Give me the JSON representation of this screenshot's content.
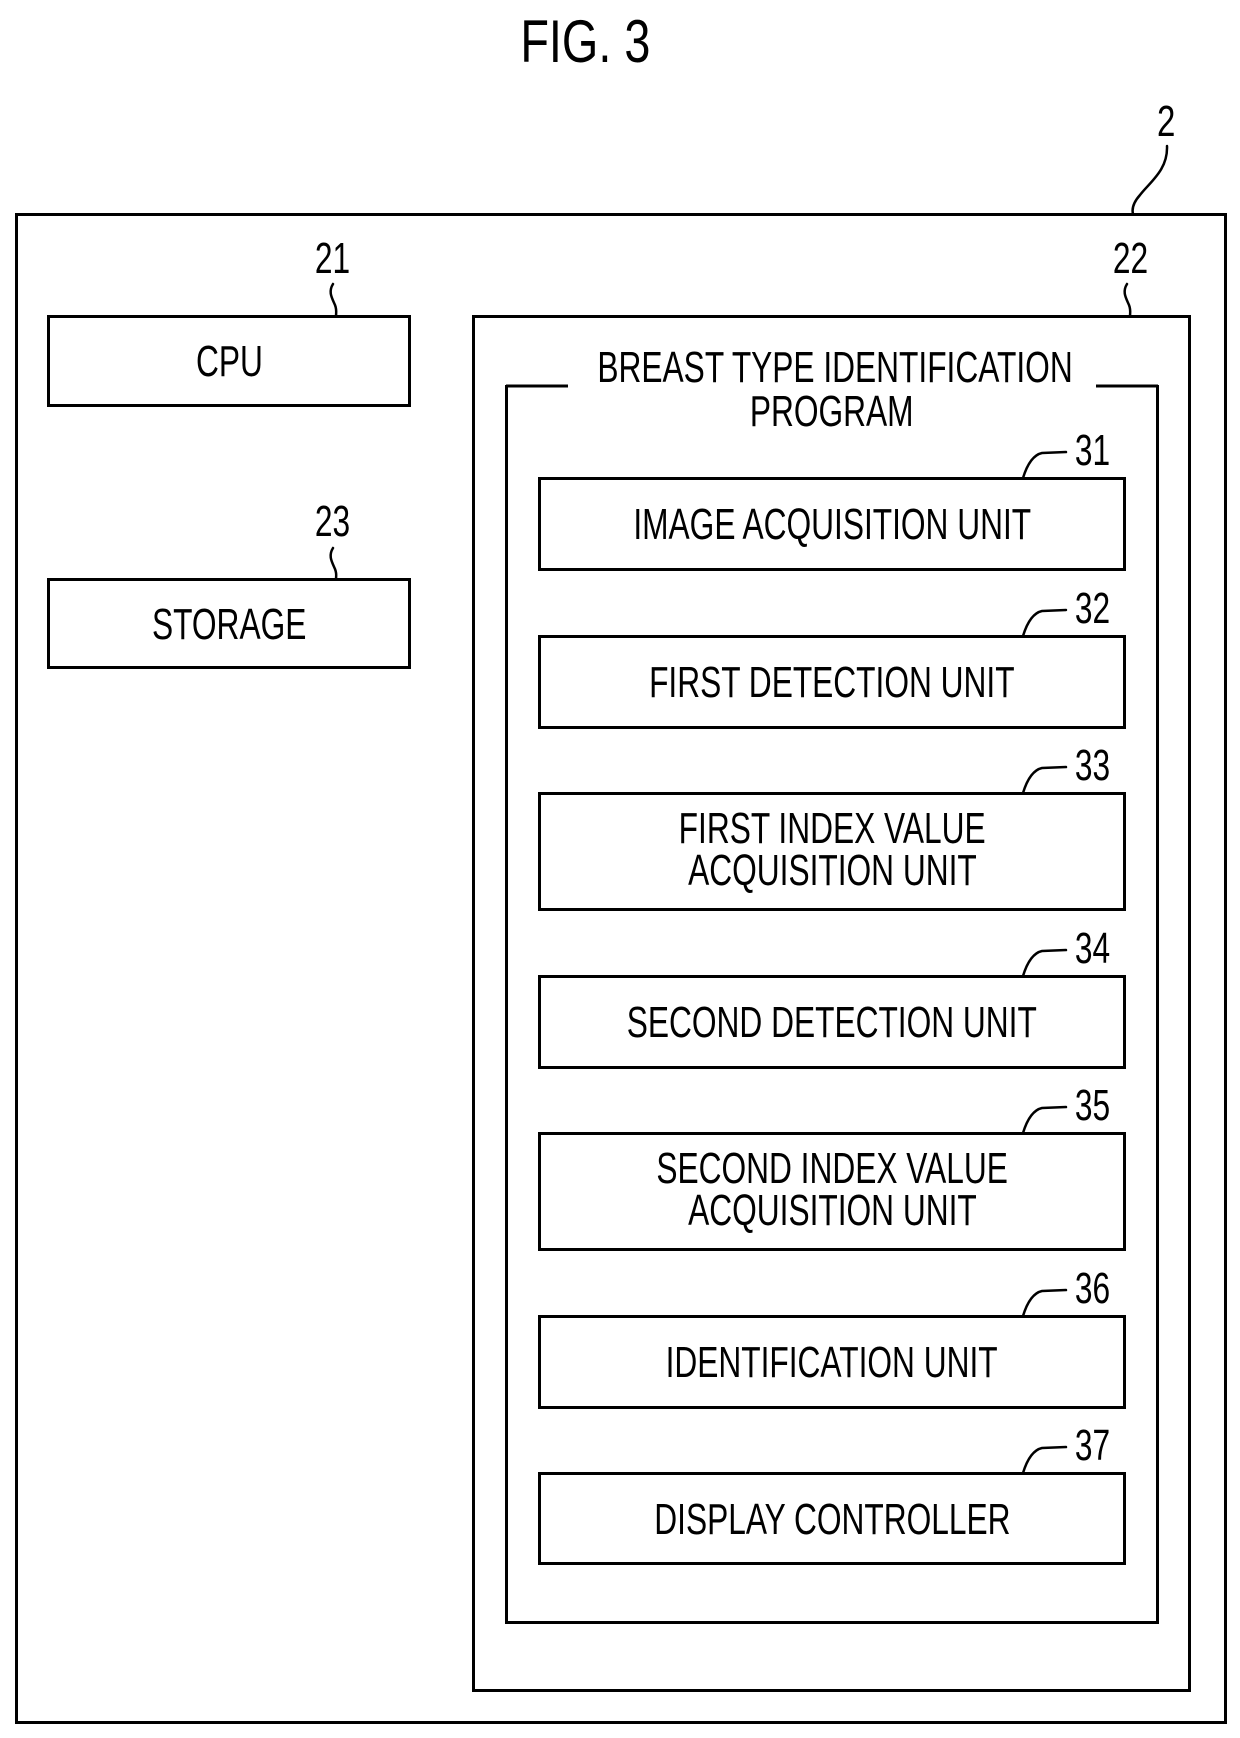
{
  "figure": {
    "title": "FIG. 3"
  },
  "device": {
    "ref": "2",
    "cpu": {
      "ref": "21",
      "label": "CPU"
    },
    "storage": {
      "ref": "23",
      "label": "STORAGE"
    },
    "memory": {
      "ref": "22",
      "program": {
        "title_line1": "BREAST TYPE IDENTIFICATION",
        "title_line2": "PROGRAM",
        "units": [
          {
            "ref": "31",
            "line1": "IMAGE ACQUISITION UNIT",
            "line2": ""
          },
          {
            "ref": "32",
            "line1": "FIRST DETECTION UNIT",
            "line2": ""
          },
          {
            "ref": "33",
            "line1": "FIRST INDEX VALUE",
            "line2": "ACQUISITION UNIT"
          },
          {
            "ref": "34",
            "line1": "SECOND DETECTION UNIT",
            "line2": ""
          },
          {
            "ref": "35",
            "line1": "SECOND INDEX VALUE",
            "line2": "ACQUISITION UNIT"
          },
          {
            "ref": "36",
            "line1": "IDENTIFICATION UNIT",
            "line2": ""
          },
          {
            "ref": "37",
            "line1": "DISPLAY CONTROLLER",
            "line2": ""
          }
        ]
      }
    }
  }
}
